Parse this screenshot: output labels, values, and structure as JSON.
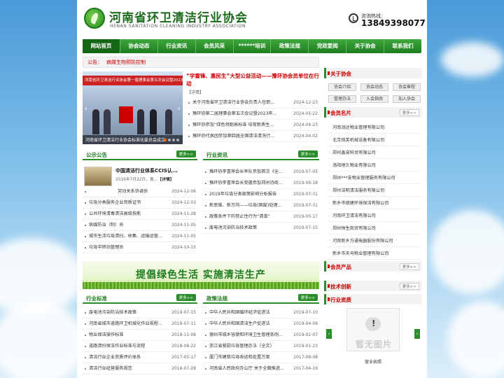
{
  "header": {
    "title": "河南省环卫清洁行业协会",
    "subtitle": "HENAN SANITATION CLEANING INDUSTRY ASSOCIATION",
    "hotline_label": "咨询热线：",
    "hotline_number": "13849398077"
  },
  "nav": {
    "items": [
      {
        "label": "网站首页"
      },
      {
        "label": "协会动态"
      },
      {
        "label": "行业资讯"
      },
      {
        "label": "会员风采"
      },
      {
        "label": "******培训"
      },
      {
        "label": "政策法规"
      },
      {
        "label": "党政要闻"
      },
      {
        "label": "关于协会"
      },
      {
        "label": "联系我们"
      }
    ]
  },
  "notice": {
    "label": "公告：",
    "text": "病媒生物预防控制"
  },
  "slider": {
    "banner_text": "河南省环卫清洁行业协会第一届理事会第五次会议暨2023年度总结大会",
    "caption": "河南省环卫清洁行业协会标准化委员会成立",
    "prev_icon": "chevron-left-icon",
    "next_icon": "chevron-right-icon"
  },
  "headline": {
    "title": "“学雷锋、惠民生”大型公益活动——豫环协会员单位在行动",
    "more": "【详情】"
  },
  "top_news": [
    {
      "title": "关于河南省环卫清洁行业协会负责人任职...",
      "date": "2024-12-23"
    },
    {
      "title": "豫环协第二届理事会第五次会议暨2023年...",
      "date": "2024-05-22"
    },
    {
      "title": "豫环协参加“绿色领跑高标准 培育新质生...",
      "date": "2024-04-23"
    },
    {
      "title": "豫环协代表团参加第四届全国清洁清洗行...",
      "date": "2024-04-02"
    }
  ],
  "announcements": {
    "label": "公示公告",
    "more": "更多>>",
    "featured_title": "中国清洁行业体系CCIS认...",
    "featured_summary": "2016年7月22日，黄...",
    "featured_detail": "【详情】",
    "items": [
      {
        "title": "劳动关系协调员",
        "date": "2024-12-06"
      },
      {
        "title": "垃圾分类服务企业资质证书",
        "date": "2024-12-03"
      },
      {
        "title": "公共环境清毒清洁高级技能",
        "date": "2024-11-28"
      },
      {
        "title": "病媒防治（制）员",
        "date": "2024-11-05"
      },
      {
        "title": "城市生活垃圾清扫、收集、运输运营...",
        "date": "2024-11-05"
      },
      {
        "title": "垃圾中转站管理员",
        "date": "2024-10-15"
      }
    ]
  },
  "industry_news": {
    "label": "行业资讯",
    "more": "更多>>",
    "items": [
      {
        "title": "豫环协李喜萍会长率队参加首次《全...",
        "date": "2019-07-05"
      },
      {
        "title": "豫环协李喜萍会长受邀参加郑州协商...",
        "date": "2019-06-18"
      },
      {
        "title": "2019年垃圾分类政策影响分析报告",
        "date": "2019-07-31"
      },
      {
        "title": "新思维、新方向——垃圾(固废)处理...",
        "date": "2019-07-31"
      },
      {
        "title": "政策条件下的禁止性行为“清单”",
        "date": "2019-05-17"
      },
      {
        "title": "废电池污染防治技术政策",
        "date": "2019-07-15"
      }
    ]
  },
  "green_banner": {
    "text": "提倡绿色生活  实施清洁生产"
  },
  "standards": {
    "label": "行业标准",
    "more": "更多>>",
    "items": [
      {
        "title": "废电池污染防治技术政策",
        "date": "2019-07-15"
      },
      {
        "title": "河南省城市道路环卫机械化作业规程...",
        "date": "2019-07-11"
      },
      {
        "title": "物业保洁操作标准",
        "date": "2018-11-08"
      },
      {
        "title": "道路清扫保洁作业标准与流程",
        "date": "2018-08-22"
      },
      {
        "title": "清洁行业企业资质评价体系",
        "date": "2017-05-17"
      },
      {
        "title": "清洁行业经营服务规范",
        "date": "2016-07-28"
      }
    ]
  },
  "policies": {
    "label": "政策法规",
    "more": "更多>>",
    "items": [
      {
        "title": "中华人民共和国循环经济促进法",
        "date": "2019-07-10"
      },
      {
        "title": "中华人民共和国清洁生产促进法",
        "date": "2019-04-09"
      },
      {
        "title": "德州市城乡容貌和环境卫生管理条例...",
        "date": "2019-02-07"
      },
      {
        "title": "浙江省餐厨垃圾管理办法（全文）",
        "date": "2019-01-23"
      },
      {
        "title": "厦门市建筑垃圾收运和处置方案",
        "date": "2017-08-08"
      },
      {
        "title": "河南省人民政府办公厅 关于全面推进...",
        "date": "2017-04-19"
      }
    ]
  },
  "about": {
    "label": "关于协会",
    "buttons": [
      "协会介绍",
      "协会动态",
      "协会章程",
      "管理办法",
      "入会指南",
      "加入协会"
    ]
  },
  "members": {
    "label": "会员名片",
    "more": "更多>>",
    "items": [
      "河南润达物业管理有限公司",
      "北京琉芙机械设备有限公司",
      "郑州鑫诺科贸有限公司",
      "洛阳地久物业有限公司",
      "郑州***友物业管理服务有限公司",
      "郑州洁明清洁服务有限公司",
      "新乡市德建环境保洁有限公司",
      "河南环卫清洁有限公司",
      "郑州恒生商贸有限公司",
      "河南新乡万通电器股份有限公司",
      "新乡市天马物业管理有限公司"
    ]
  },
  "products": {
    "label": "会员产品",
    "more": "更多>>"
  },
  "tech": {
    "label": "技术创新",
    "more": "更多>>"
  },
  "qualifications": {
    "label": "行业资质",
    "placeholder_text": "暂无图片",
    "caption": "营业执照"
  }
}
